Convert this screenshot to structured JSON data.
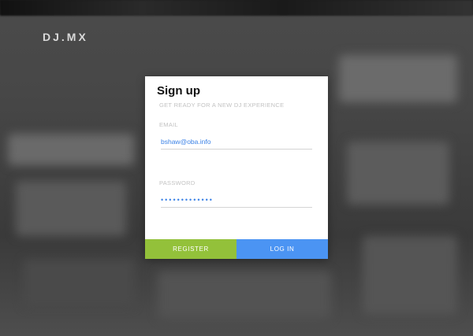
{
  "brand": {
    "name": "DJ.MX"
  },
  "signup_card": {
    "title": "Sign up",
    "subtitle": "GET READY FOR A NEW DJ EXPERIENCE",
    "email": {
      "label": "EMAIL",
      "value": "bshaw@oba.info"
    },
    "password": {
      "label": "PASSWORD",
      "value": "•••••••••••••"
    },
    "register_label": "REGISTER",
    "login_label": "LOG IN"
  },
  "colors": {
    "register": "#93c13a",
    "login": "#4b94f3",
    "input_text": "#3b82e6"
  }
}
